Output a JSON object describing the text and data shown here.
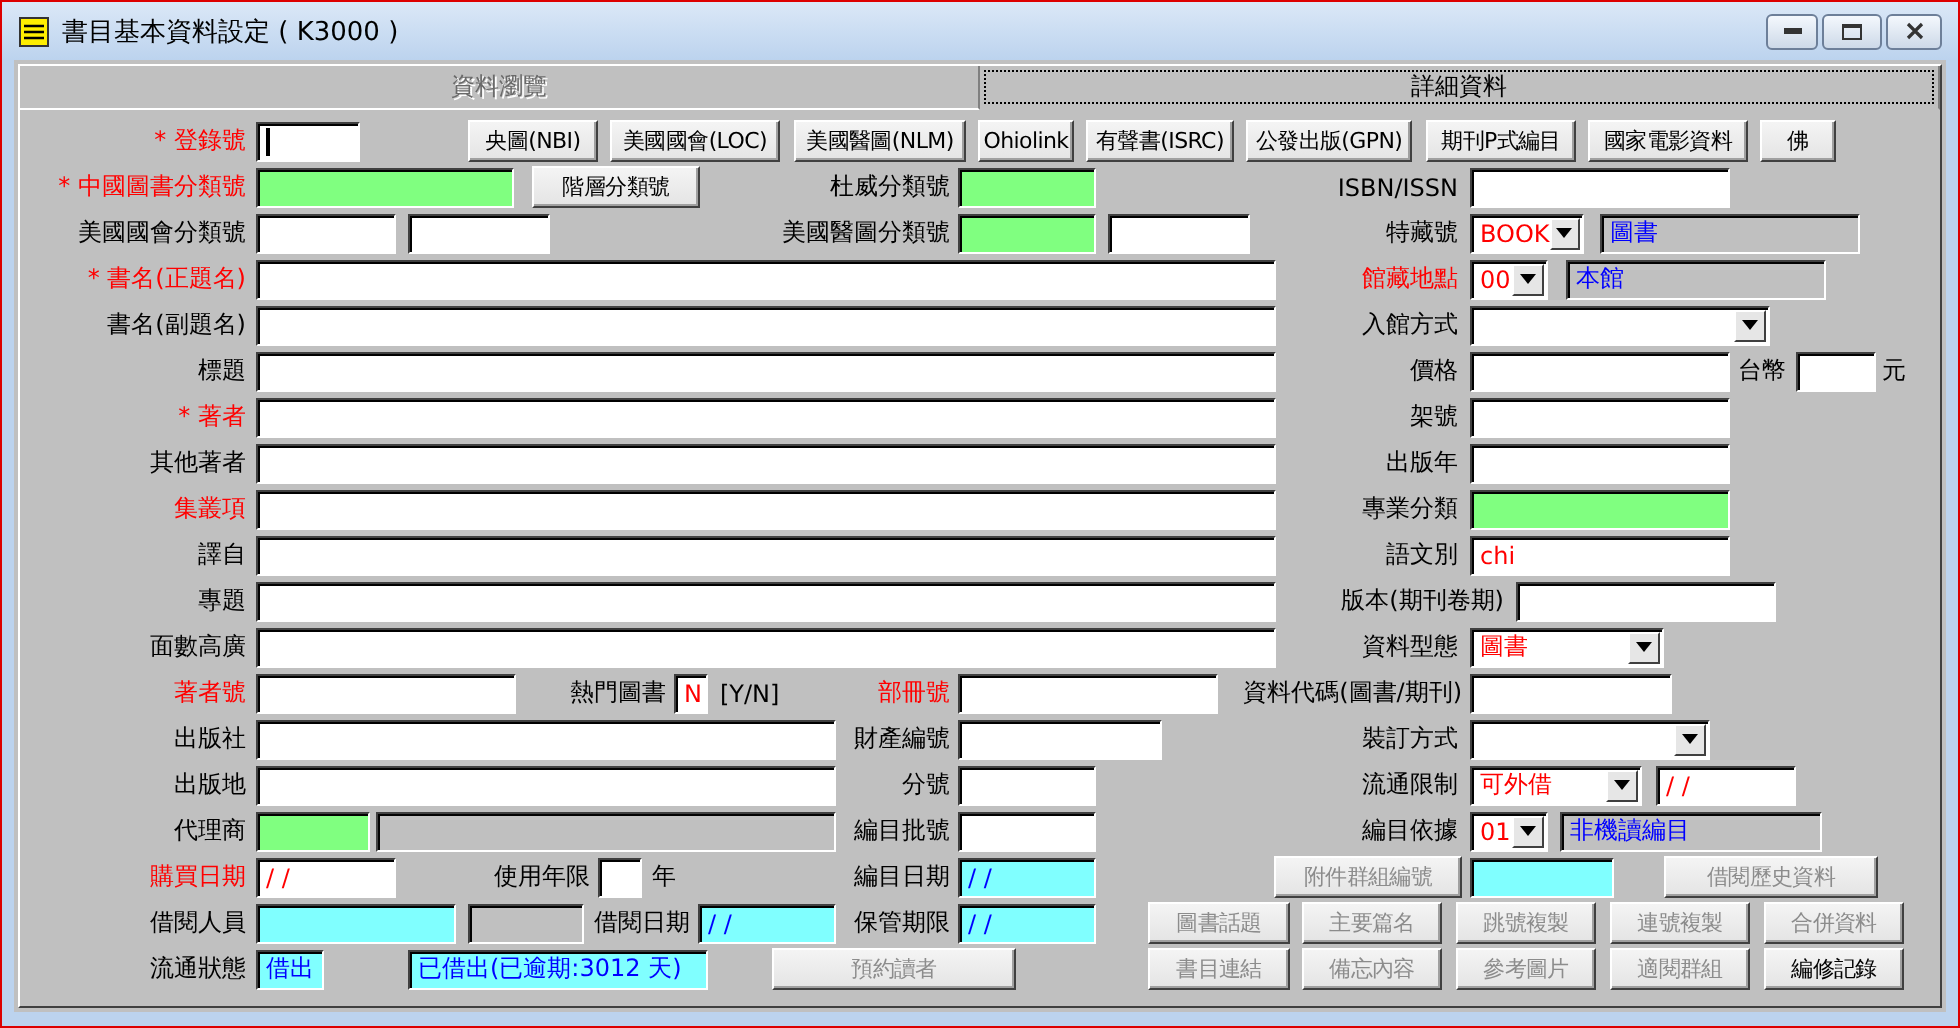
{
  "window": {
    "title": "書目基本資料設定 ( K3000 )"
  },
  "tabs": [
    {
      "label": "資料瀏覽",
      "selected": false,
      "disabled": true
    },
    {
      "label": "詳細資料",
      "selected": true,
      "disabled": false
    }
  ],
  "rows": [
    [
      {
        "kind": "label",
        "text": "* 登錄號",
        "highlighted": true
      },
      {
        "kind": "field",
        "color": "#ffffff",
        "focused": true
      },
      {
        "kind": "button",
        "label": "央圖(NBI)",
        "disabled": false
      },
      {
        "kind": "button",
        "label": "美國國會(LOC)",
        "disabled": false
      },
      {
        "kind": "button",
        "label": "美國醫圖(NLM)",
        "disabled": false
      },
      {
        "kind": "button",
        "label": "Ohiolink",
        "disabled": false
      },
      {
        "kind": "button",
        "label": "有聲書(ISRC)",
        "disabled": false
      },
      {
        "kind": "button",
        "label": "公發出版(GPN)",
        "disabled": false
      },
      {
        "kind": "button",
        "label": "期刊P式編目",
        "disabled": false
      },
      {
        "kind": "button",
        "label": "國家電影資料",
        "disabled": false
      },
      {
        "kind": "button",
        "label": "佛",
        "disabled": false
      }
    ],
    [
      {
        "kind": "label",
        "text": "* 中國圖書分類號",
        "highlighted": true
      },
      {
        "kind": "field",
        "color": "#80ff80"
      },
      {
        "kind": "button",
        "label": "階層分類號",
        "disabled": false
      },
      {
        "kind": "label",
        "text": "杜威分類號",
        "highlighted": false
      },
      {
        "kind": "field",
        "color": "#80ff80"
      },
      {
        "kind": "label",
        "text": "ISBN/ISSN",
        "highlighted": false
      },
      {
        "kind": "field",
        "color": "#ffffff"
      }
    ],
    [
      {
        "kind": "label",
        "text": "美國國會分類號",
        "highlighted": false
      },
      {
        "kind": "field",
        "color": "#ffffff"
      },
      {
        "kind": "field",
        "color": "#ffffff"
      },
      {
        "kind": "label",
        "text": "美國醫圖分類號",
        "highlighted": false
      },
      {
        "kind": "field",
        "color": "#80ff80"
      },
      {
        "kind": "field",
        "color": "#ffffff"
      },
      {
        "kind": "label",
        "text": "特藏號",
        "highlighted": false
      },
      {
        "kind": "combo",
        "value": "BOOK",
        "emphasized": true
      },
      {
        "kind": "field",
        "color": "#c0c0c0",
        "value": "圖書",
        "emphasized": false
      }
    ],
    [
      {
        "kind": "label",
        "text": "* 書名(正題名)",
        "highlighted": true
      },
      {
        "kind": "field",
        "color": "#ffffff"
      },
      {
        "kind": "label",
        "text": "館藏地點",
        "highlighted": true
      },
      {
        "kind": "combo",
        "value": "00",
        "emphasized": true
      },
      {
        "kind": "field",
        "color": "#c0c0c0",
        "value": "本館",
        "emphasized": false
      }
    ],
    [
      {
        "kind": "label",
        "text": "書名(副題名)",
        "highlighted": false
      },
      {
        "kind": "field",
        "color": "#ffffff"
      },
      {
        "kind": "label",
        "text": "入館方式",
        "highlighted": false
      },
      {
        "kind": "combo"
      }
    ],
    [
      {
        "kind": "label",
        "text": "標題",
        "highlighted": false
      },
      {
        "kind": "field",
        "color": "#ffffff"
      },
      {
        "kind": "label",
        "text": "價格",
        "highlighted": false
      },
      {
        "kind": "field",
        "color": "#ffffff"
      },
      {
        "kind": "label",
        "text": "台幣",
        "highlighted": false
      },
      {
        "kind": "field",
        "color": "#ffffff"
      },
      {
        "kind": "label",
        "text": "元",
        "highlighted": false
      }
    ],
    [
      {
        "kind": "label",
        "text": "* 著者",
        "highlighted": true
      },
      {
        "kind": "field",
        "color": "#ffffff"
      },
      {
        "kind": "label",
        "text": "架號",
        "highlighted": false
      },
      {
        "kind": "field",
        "color": "#ffffff"
      }
    ],
    [
      {
        "kind": "label",
        "text": "其他著者",
        "highlighted": false
      },
      {
        "kind": "field",
        "color": "#ffffff"
      },
      {
        "kind": "label",
        "text": "出版年",
        "highlighted": false
      },
      {
        "kind": "field",
        "color": "#ffffff"
      }
    ],
    [
      {
        "kind": "label",
        "text": "集叢項",
        "highlighted": true
      },
      {
        "kind": "field",
        "color": "#ffffff"
      },
      {
        "kind": "label",
        "text": "專業分類",
        "highlighted": false
      },
      {
        "kind": "field",
        "color": "#80ff80"
      }
    ],
    [
      {
        "kind": "label",
        "text": "譯自",
        "highlighted": false
      },
      {
        "kind": "field",
        "color": "#ffffff"
      },
      {
        "kind": "label",
        "text": "語文別",
        "highlighted": false
      },
      {
        "kind": "field",
        "color": "#ffffff",
        "value": "chi",
        "emphasized": true
      }
    ],
    [
      {
        "kind": "label",
        "text": "專題",
        "highlighted": false
      },
      {
        "kind": "field",
        "color": "#ffffff"
      },
      {
        "kind": "label",
        "text": "版本(期刊卷期)",
        "highlighted": false
      },
      {
        "kind": "field",
        "color": "#ffffff"
      }
    ],
    [
      {
        "kind": "label",
        "text": "面數高廣",
        "highlighted": false
      },
      {
        "kind": "field",
        "color": "#ffffff"
      },
      {
        "kind": "label",
        "text": "資料型態",
        "highlighted": false
      },
      {
        "kind": "combo",
        "value": "圖書",
        "emphasized": true
      }
    ],
    [
      {
        "kind": "label",
        "text": "著者號",
        "highlighted": true
      },
      {
        "kind": "field",
        "color": "#ffffff"
      },
      {
        "kind": "label",
        "text": "熱門圖書",
        "highlighted": false
      },
      {
        "kind": "field",
        "color": "#ffffff",
        "value": "N",
        "emphasized": true
      },
      {
        "kind": "label",
        "text": "[Y/N]",
        "highlighted": false
      },
      {
        "kind": "label",
        "text": "部冊號",
        "highlighted": true
      },
      {
        "kind": "field",
        "color": "#ffffff"
      },
      {
        "kind": "label",
        "text": "資料代碼(圖書/期刊)",
        "highlighted": false
      },
      {
        "kind": "field",
        "color": "#ffffff"
      }
    ],
    [
      {
        "kind": "label",
        "text": "出版社",
        "highlighted": false
      },
      {
        "kind": "field",
        "color": "#ffffff"
      },
      {
        "kind": "label",
        "text": "財產編號",
        "highlighted": false
      },
      {
        "kind": "field",
        "color": "#ffffff"
      },
      {
        "kind": "label",
        "text": "裝訂方式",
        "highlighted": false
      },
      {
        "kind": "combo"
      }
    ],
    [
      {
        "kind": "label",
        "text": "出版地",
        "highlighted": false
      },
      {
        "kind": "field",
        "color": "#ffffff"
      },
      {
        "kind": "label",
        "text": "分號",
        "highlighted": false
      },
      {
        "kind": "field",
        "color": "#ffffff"
      },
      {
        "kind": "label",
        "text": "流通限制",
        "highlighted": false
      },
      {
        "kind": "combo",
        "value": "可外借",
        "emphasized": true
      },
      {
        "kind": "field",
        "color": "#ffffff",
        "value": "/  /",
        "emphasized": true
      }
    ],
    [
      {
        "kind": "label",
        "text": "代理商",
        "highlighted": false
      },
      {
        "kind": "field",
        "color": "#80ff80"
      },
      {
        "kind": "field",
        "color": "#c0c0c0"
      },
      {
        "kind": "label",
        "text": "編目批號",
        "highlighted": false
      },
      {
        "kind": "field",
        "color": "#ffffff"
      },
      {
        "kind": "label",
        "text": "編目依據",
        "highlighted": false
      },
      {
        "kind": "combo",
        "value": "01",
        "emphasized": true
      },
      {
        "kind": "field",
        "color": "#c0c0c0",
        "value": "非機讀編目",
        "emphasized": false
      }
    ],
    [
      {
        "kind": "label",
        "text": "購買日期",
        "highlighted": true
      },
      {
        "kind": "field",
        "color": "#ffffff",
        "value": "/  /",
        "emphasized": true
      },
      {
        "kind": "label",
        "text": "使用年限",
        "highlighted": false
      },
      {
        "kind": "field",
        "color": "#ffffff"
      },
      {
        "kind": "label",
        "text": "年",
        "highlighted": false
      },
      {
        "kind": "label",
        "text": "編目日期",
        "highlighted": false
      },
      {
        "kind": "field",
        "color": "#80ffff",
        "value": "/  /",
        "emphasized": false
      },
      {
        "kind": "button",
        "label": "附件群組編號",
        "disabled": true
      },
      {
        "kind": "field",
        "color": "#80ffff"
      },
      {
        "kind": "button",
        "label": "借閱歷史資料",
        "disabled": true
      }
    ],
    [
      {
        "kind": "label",
        "text": "借閱人員",
        "highlighted": false
      },
      {
        "kind": "field",
        "color": "#80ffff"
      },
      {
        "kind": "field",
        "color": "#c0c0c0"
      },
      {
        "kind": "label",
        "text": "借閱日期",
        "highlighted": false
      },
      {
        "kind": "field",
        "color": "#80ffff",
        "value": "/  /",
        "emphasized": false
      },
      {
        "kind": "label",
        "text": "保管期限",
        "highlighted": false
      },
      {
        "kind": "field",
        "color": "#80ffff",
        "value": "/  /",
        "emphasized": false
      },
      {
        "kind": "button",
        "label": "圖書話題",
        "disabled": true
      },
      {
        "kind": "button",
        "label": "主要篇名",
        "disabled": true
      },
      {
        "kind": "button",
        "label": "跳號複製",
        "disabled": true
      },
      {
        "kind": "button",
        "label": "連號複製",
        "disabled": true
      },
      {
        "kind": "button",
        "label": "合併資料",
        "disabled": true
      }
    ],
    [
      {
        "kind": "label",
        "text": "流通狀態",
        "highlighted": false
      },
      {
        "kind": "field",
        "color": "#80ffff",
        "value": "借出",
        "emphasized": false
      },
      {
        "kind": "field",
        "color": "#80ffff",
        "value": "已借出(已逾期:3012 天)",
        "emphasized": false
      },
      {
        "kind": "button",
        "label": "預約讀者",
        "disabled": true
      },
      {
        "kind": "button",
        "label": "書目連結",
        "disabled": true
      },
      {
        "kind": "button",
        "label": "備忘內容",
        "disabled": true
      },
      {
        "kind": "button",
        "label": "參考圖片",
        "disabled": true
      },
      {
        "kind": "button",
        "label": "適閱群組",
        "disabled": true
      },
      {
        "kind": "button",
        "label": "編修記錄",
        "disabled": false
      }
    ]
  ]
}
